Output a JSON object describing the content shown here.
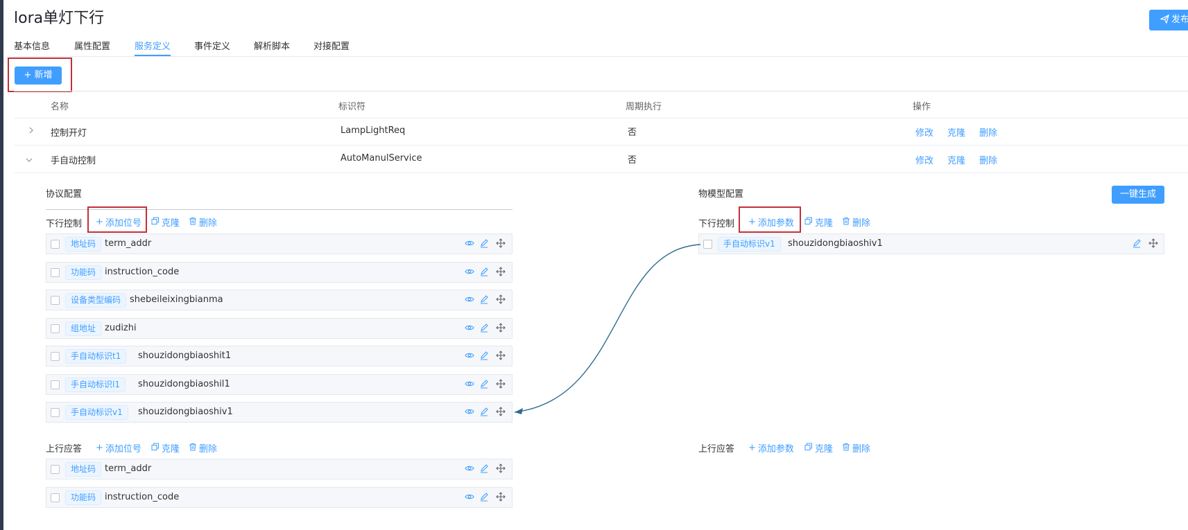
{
  "page": {
    "title": "lora单灯下行",
    "publish_label": "发布"
  },
  "tabs": [
    "基本信息",
    "属性配置",
    "服务定义",
    "事件定义",
    "解析脚本",
    "对接配置"
  ],
  "toolbar": {
    "add_label": "新增"
  },
  "table": {
    "headers": [
      "名称",
      "标识符",
      "周期执行",
      "操作"
    ],
    "rows": [
      {
        "name": "控制开灯",
        "identifier": "LampLightReq",
        "periodic": "否",
        "actions": [
          "修改",
          "克隆",
          "删除"
        ]
      },
      {
        "name": "手自动控制",
        "identifier": "AutoManulService",
        "periodic": "否",
        "actions": [
          "修改",
          "克隆",
          "删除"
        ]
      }
    ]
  },
  "protocol": {
    "title": "协议配置",
    "downlink": {
      "label": "下行控制",
      "add": "添加位号",
      "clone": "克隆",
      "delete": "删除"
    },
    "items": [
      {
        "tag": "地址码",
        "name": "term_addr"
      },
      {
        "tag": "功能码",
        "name": "instruction_code"
      },
      {
        "tag": "设备类型编码",
        "name": "shebeileixingbianma"
      },
      {
        "tag": "组地址",
        "name": "zudizhi"
      },
      {
        "tag": "手自动标识t1",
        "name": "shouzidongbiaoshit1"
      },
      {
        "tag": "手自动标识l1",
        "name": "shouzidongbiaoshil1"
      },
      {
        "tag": "手自动标识v1",
        "name": "shouzidongbiaoshiv1"
      }
    ],
    "uplink": {
      "label": "上行应答",
      "add": "添加位号",
      "clone": "克隆",
      "delete": "删除"
    },
    "up_items": [
      {
        "tag": "地址码",
        "name": "term_addr"
      },
      {
        "tag": "功能码",
        "name": "instruction_code"
      }
    ]
  },
  "model": {
    "title": "物模型配置",
    "generate_label": "一键生成",
    "downlink": {
      "label": "下行控制",
      "add": "添加参数",
      "clone": "克隆",
      "delete": "删除"
    },
    "items": [
      {
        "tag": "手自动标识v1",
        "name": "shouzidongbiaoshiv1"
      }
    ],
    "uplink": {
      "label": "上行应答",
      "add": "添加参数",
      "clone": "克隆",
      "delete": "删除"
    }
  },
  "colors": {
    "primary": "#409eff",
    "highlight_box": "#c0303a",
    "connector": "#2d6a8f"
  }
}
